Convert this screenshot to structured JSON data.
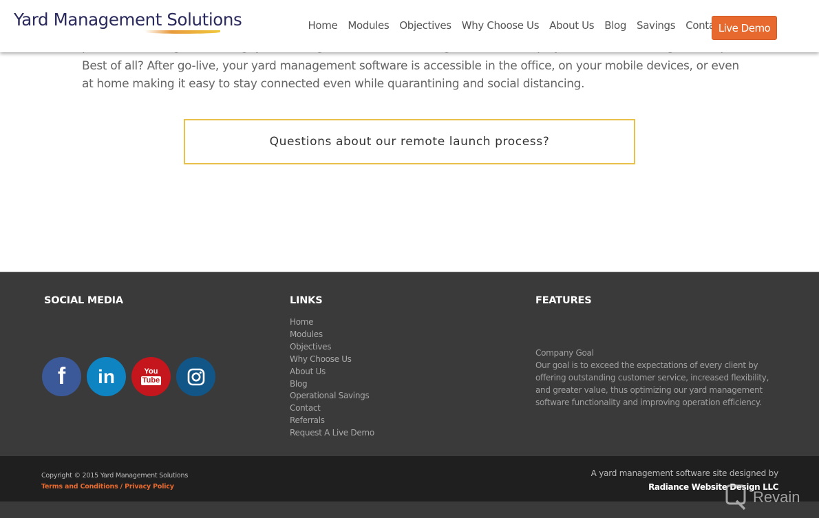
{
  "header": {
    "logo": "Yard Management Solutions",
    "nav": [
      "Home",
      "Modules",
      "Objectives",
      "Why Choose Us",
      "About Us",
      "Blog",
      "Savings",
      "Contact"
    ],
    "demo_button": "Live Demo"
  },
  "main": {
    "partial_line": "process including onboarding, yard management software configuration, full employee software training, and implementation.",
    "paragraph": "Best of all? After go-live, your yard management software is accessible in the office, on your mobile devices, or even at home making it easy to stay connected even while quarantining and social distancing.",
    "cta": "Questions about our remote launch process?"
  },
  "footer": {
    "social_heading": "SOCIAL MEDIA",
    "social": [
      {
        "name": "facebook",
        "glyph": "f"
      },
      {
        "name": "linkedin",
        "glyph": "in"
      },
      {
        "name": "youtube",
        "glyph_top": "You",
        "glyph_bottom": "Tube"
      },
      {
        "name": "instagram"
      }
    ],
    "links_heading": "LINKS",
    "links": [
      "Home",
      "Modules",
      "Objectives",
      "Why Choose Us",
      "About Us",
      "Blog",
      "Operational Savings",
      "Contact",
      "Referrals",
      "Request A Live Demo"
    ],
    "features_heading": "FEATURES",
    "features_title": "Company Goal",
    "features_text": "Our goal is to exceed the expectations of every client by offering outstanding customer service, increased flexibility, and greater value, thus optimizing our yard management software functionality and improving operation efficiency."
  },
  "bottom": {
    "copyright": "Copyright © 2015 Yard Management Solutions",
    "terms": "Terms and Conditions",
    "separator": " / ",
    "privacy": "Privacy Policy",
    "designed_by": "A yard management software site designed by",
    "designer": "Radiance Website Design LLC"
  },
  "watermark": "Revain",
  "colors": {
    "accent_orange": "#e8692e",
    "logo_navy": "#2b2a5c",
    "cta_border": "#e8c04a",
    "footer_bg": "#3a3a3a",
    "bottom_bg": "#1f1f1f"
  }
}
